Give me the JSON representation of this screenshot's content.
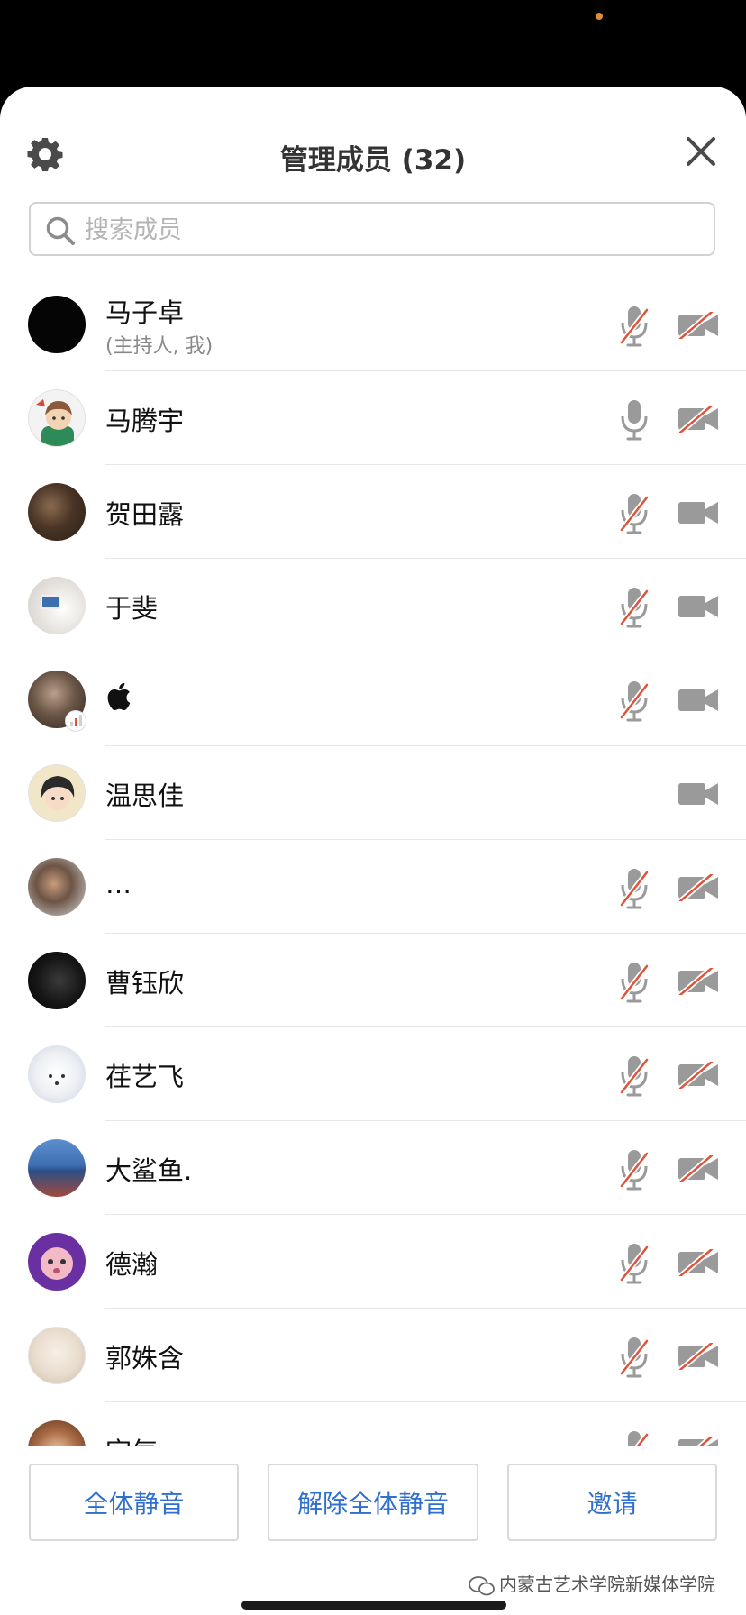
{
  "header": {
    "title": "管理成员 (32)",
    "settings_icon": "gear-icon",
    "close_icon": "close-icon"
  },
  "search": {
    "placeholder": "搜索成员",
    "value": ""
  },
  "colors": {
    "accent": "#2f6fce",
    "muted_icon": "#9a9a9a",
    "muted_slash": "#e0523a"
  },
  "members": [
    {
      "name": "马子卓",
      "subtitle": "(主持人, 我)",
      "avatar": "black-avatar",
      "mic": "muted",
      "camera": "off"
    },
    {
      "name": "马腾宇",
      "avatar": "cartoon-boy-avatar",
      "mic": "on",
      "camera": "off"
    },
    {
      "name": "贺田露",
      "avatar": "photo-avatar",
      "mic": "muted",
      "camera": "on"
    },
    {
      "name": "于斐",
      "avatar": "photo-avatar",
      "mic": "muted",
      "camera": "on"
    },
    {
      "name": "",
      "avatar": "photo-avatar",
      "name_icon": "apple-logo-icon",
      "badge": "signal-badge-icon",
      "mic": "muted",
      "camera": "on"
    },
    {
      "name": "温思佳",
      "avatar": "anime-avatar",
      "mic": "none",
      "camera": "on"
    },
    {
      "name": "…",
      "avatar": "photo-avatar",
      "mic": "muted",
      "camera": "off"
    },
    {
      "name": "曹钰欣",
      "avatar": "dark-photo-avatar",
      "mic": "muted",
      "camera": "off"
    },
    {
      "name": "荏艺飞",
      "avatar": "white-fox-avatar",
      "mic": "muted",
      "camera": "off"
    },
    {
      "name": "大鲨鱼.",
      "avatar": "photo-avatar",
      "mic": "muted",
      "camera": "off"
    },
    {
      "name": "德瀚",
      "avatar": "purple-cartoon-avatar",
      "mic": "muted",
      "camera": "off"
    },
    {
      "name": "郭姝含",
      "avatar": "illustration-avatar",
      "mic": "muted",
      "camera": "off"
    },
    {
      "name": "宗气",
      "avatar": "photo-avatar",
      "mic": "muted",
      "camera": "off"
    }
  ],
  "footer": {
    "mute_all_label": "全体静音",
    "unmute_all_label": "解除全体静音",
    "invite_label": "邀请",
    "watermark": "内蒙古艺术学院新媒体学院"
  }
}
